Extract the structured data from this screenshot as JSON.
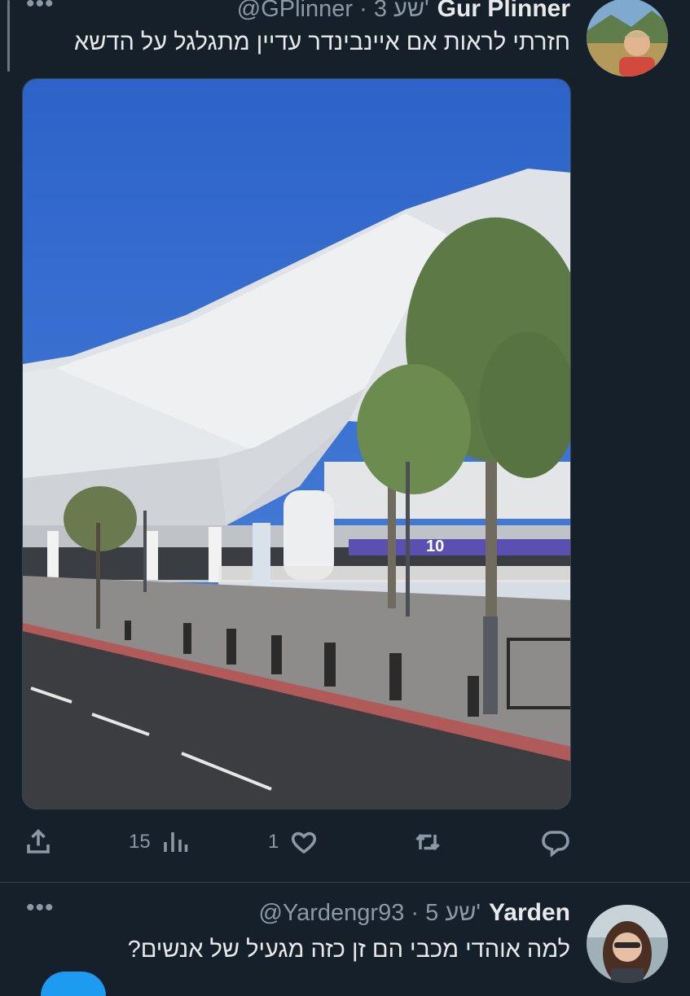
{
  "tweets": [
    {
      "name": "Gur Plinner",
      "handle": "@GPlinner",
      "time": "3 שע'",
      "text": "חזרתי לראות אם איינבינדר עדיין מתגלגל על הדשא",
      "photo_sign_number": "10",
      "actions": {
        "views": "15",
        "likes": "1"
      }
    },
    {
      "name": "Yarden",
      "handle": "@Yardengr93",
      "time": "5 שע'",
      "text": "למה אוהדי מכבי הם זן כזה מגעיל של אנשים?"
    }
  ],
  "separator_dot": "·",
  "more_glyph": "•••",
  "colors": {
    "background": "#15202b",
    "text_primary": "#e7e9ea",
    "text_secondary": "#8b98a5",
    "accent": "#1d9bf0",
    "divider": "#38444d"
  },
  "icons": [
    "more-icon",
    "share-icon",
    "views-icon",
    "like-icon",
    "retweet-icon",
    "reply-icon"
  ]
}
